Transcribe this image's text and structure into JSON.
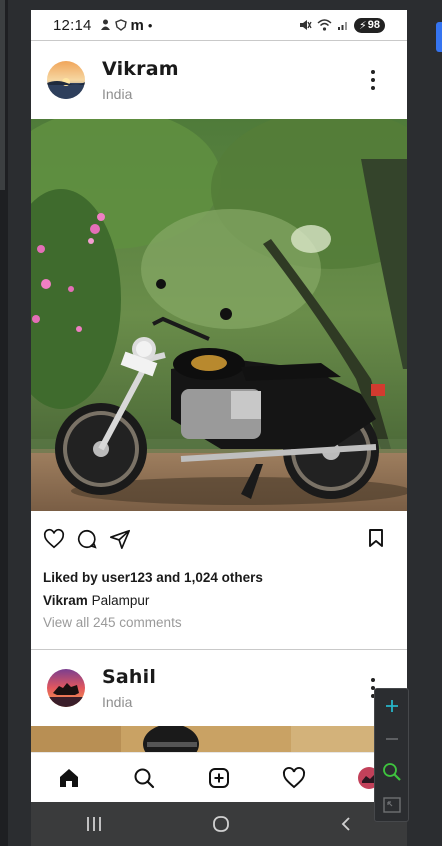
{
  "status": {
    "time": "12:14",
    "battery": "98"
  },
  "posts": [
    {
      "username": "Vikram",
      "location": "India",
      "likes_text": "Liked by user123 and 1,024 others",
      "caption_user": "Vikram",
      "caption_text": "Palampur",
      "comments_text": "View all 245 comments",
      "image": "motorcycle-photo"
    },
    {
      "username": "Sahil",
      "location": "India",
      "image": "rider-photo"
    }
  ],
  "bottom_nav": [
    "home-icon",
    "search-icon",
    "add-post-icon",
    "heart-icon",
    "profile-avatar"
  ],
  "system_nav": [
    "recents-icon",
    "home-circle-icon",
    "back-icon"
  ],
  "zoom_controls": [
    "zoom-in",
    "zoom-out",
    "zoom-actual",
    "zoom-fit"
  ],
  "colors": {
    "accent": "#3574f0",
    "zoom_in": "#27b5c8",
    "zoom_actual": "#3ec43e"
  }
}
